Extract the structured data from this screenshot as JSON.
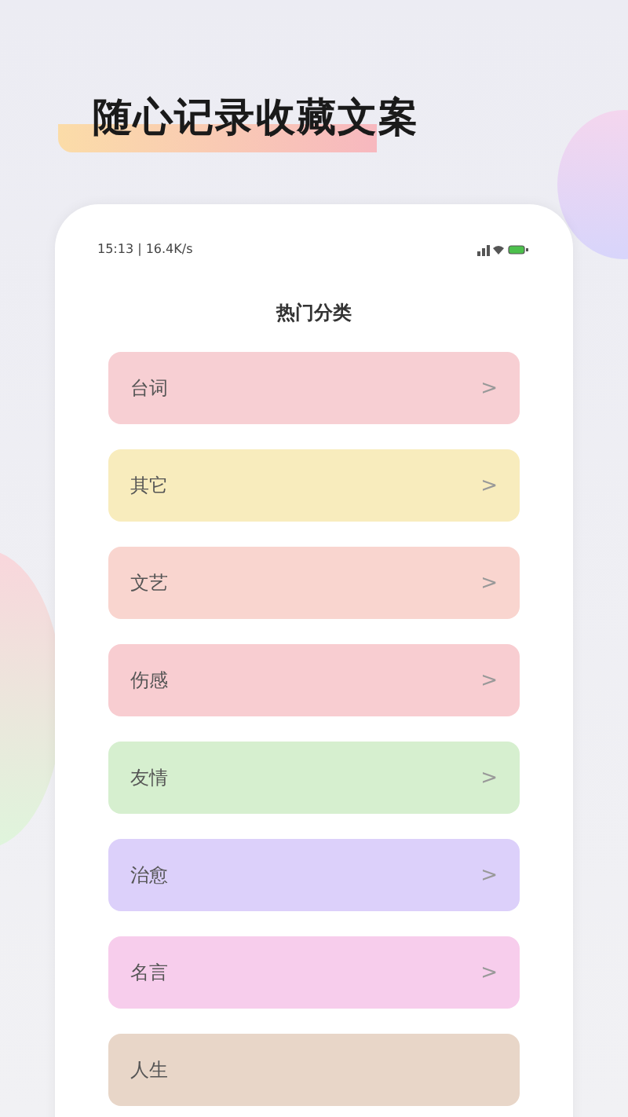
{
  "headline": "随心记录收藏文案",
  "status_bar": {
    "time_speed": "15:13 | 16.4K/s"
  },
  "page_title": "热门分类",
  "categories": [
    {
      "label": "台词",
      "chevron": ">",
      "color": "#f7cfd3"
    },
    {
      "label": "其它",
      "chevron": ">",
      "color": "#f8ecbd"
    },
    {
      "label": "文艺",
      "chevron": ">",
      "color": "#f9d5cf"
    },
    {
      "label": "伤感",
      "chevron": ">",
      "color": "#f8cdd1"
    },
    {
      "label": "友情",
      "chevron": ">",
      "color": "#d6efcf"
    },
    {
      "label": "治愈",
      "chevron": ">",
      "color": "#dcd0fa"
    },
    {
      "label": "名言",
      "chevron": ">",
      "color": "#f7cdec"
    },
    {
      "label": "人生",
      "color": "#e8d6c8"
    }
  ]
}
